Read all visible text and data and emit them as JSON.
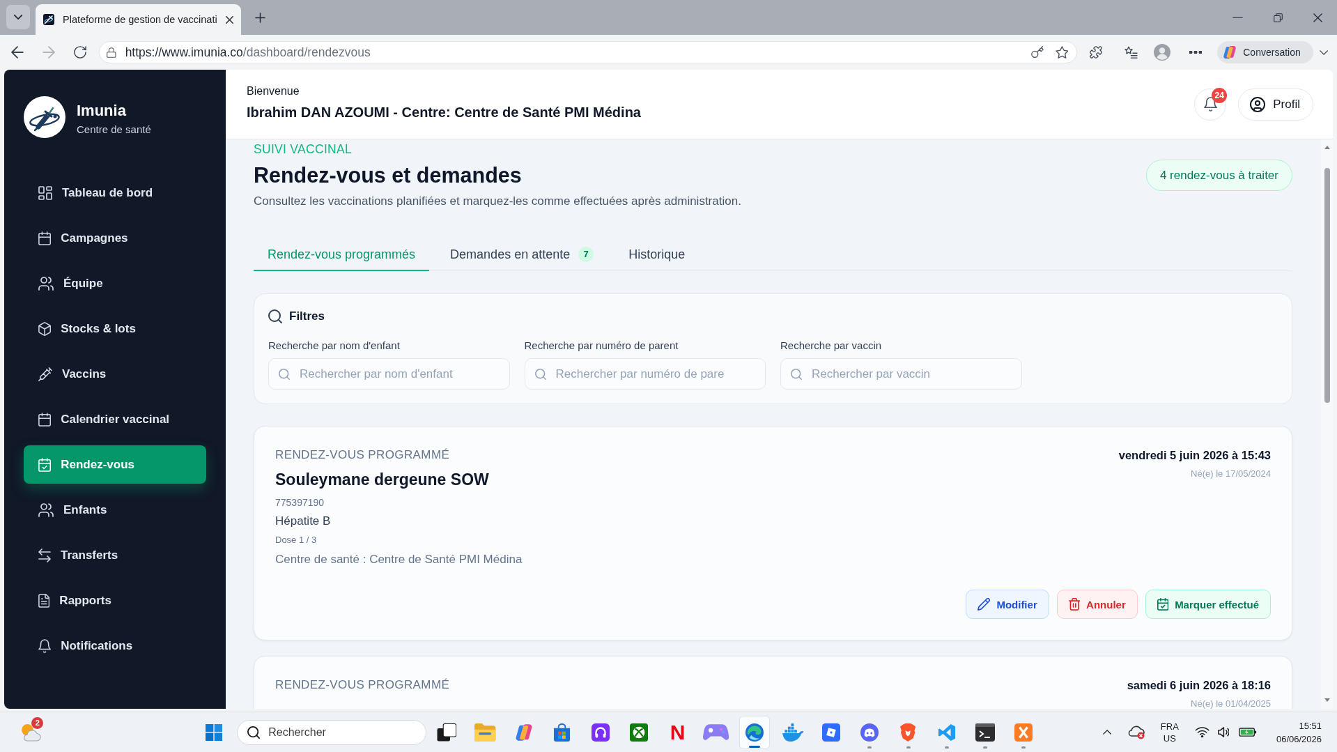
{
  "browser": {
    "tab": {
      "title": "Plateforme de gestion de vaccinati"
    },
    "nav": [
      {
        "kind": "back",
        "disabled": false
      },
      {
        "kind": "forward",
        "disabled": true
      },
      {
        "kind": "reload",
        "disabled": false
      }
    ],
    "address": {
      "origin": "https://www.imunia.co",
      "path": "/dashboard/rendezvous"
    },
    "assistant": {
      "label": "Conversation"
    }
  },
  "sidebar": {
    "brand": {
      "name": "Imunia",
      "subtitle": "Centre de santé"
    },
    "items": [
      {
        "kind": "dashboard",
        "label": "Tableau de bord",
        "selected": false
      },
      {
        "kind": "campaigns",
        "label": "Campagnes",
        "selected": false
      },
      {
        "kind": "team",
        "label": "Équipe",
        "selected": false
      },
      {
        "kind": "stock",
        "label": "Stocks & lots",
        "selected": false
      },
      {
        "kind": "vaccine",
        "label": "Vaccins",
        "selected": false
      },
      {
        "kind": "schedule",
        "label": "Calendrier vaccinal",
        "selected": false
      },
      {
        "kind": "appointments",
        "label": "Rendez-vous",
        "selected": true
      },
      {
        "kind": "children",
        "label": "Enfants",
        "selected": false
      },
      {
        "kind": "transfers",
        "label": "Transferts",
        "selected": false
      },
      {
        "kind": "reports",
        "label": "Rapports",
        "selected": false
      },
      {
        "kind": "notifications",
        "label": "Notifications",
        "selected": false
      }
    ]
  },
  "header": {
    "greeting": "Bienvenue",
    "user": "Ibrahim DAN AZOUMI - Centre: Centre de Santé PMI Médina",
    "notifications": {
      "count": "24"
    },
    "profile": {
      "label": "Profil"
    }
  },
  "page": {
    "eyebrow": "SUIVI VACCINAL",
    "title": "Rendez-vous et demandes",
    "description": "Consultez les vaccinations planifiées et marquez-les comme effectuées après administration.",
    "badge": "4 rendez-vous à traiter"
  },
  "tabs": [
    {
      "label": "Rendez-vous programmés",
      "selected": true
    },
    {
      "label": "Demandes en attente",
      "count": "7",
      "selected": false
    },
    {
      "label": "Historique",
      "selected": false
    }
  ],
  "filters": {
    "title": "Filtres",
    "fields": [
      {
        "label": "Recherche par nom d'enfant",
        "placeholder": "Rechercher par nom d'enfant"
      },
      {
        "label": "Recherche par numéro de parent",
        "placeholder": "Rechercher par numéro de pare"
      },
      {
        "label": "Recherche par vaccin",
        "placeholder": "Rechercher par vaccin"
      }
    ]
  },
  "appointments": [
    {
      "status": "RENDEZ-VOUS PROGRAMMÉ",
      "child": "Souleymane dergeune SOW",
      "phone": "775397190",
      "vaccine": "Hépatite B",
      "dose": "Dose 1 / 3",
      "center": "Centre de santé : Centre de Santé PMI Médina",
      "datetime": "vendredi 5 juin 2026 à 15:43",
      "birth": "Né(e) le 17/05/2024",
      "actions": [
        {
          "kind": "edit",
          "label": "Modifier"
        },
        {
          "kind": "cancel",
          "label": "Annuler"
        },
        {
          "kind": "done",
          "label": "Marquer effectué"
        }
      ]
    },
    {
      "status": "RENDEZ-VOUS PROGRAMMÉ",
      "datetime": "samedi 6 juin 2026 à 18:16",
      "birth": "Né(e) le 01/04/2025"
    }
  ],
  "taskbar": {
    "weather": {
      "badge": "2"
    },
    "search": {
      "placeholder": "Rechercher"
    },
    "apps": [
      {
        "kind": "taskview",
        "running": false,
        "selected": false
      },
      {
        "kind": "folder",
        "running": false,
        "selected": false
      },
      {
        "kind": "swirl",
        "running": false,
        "selected": false
      },
      {
        "kind": "bag",
        "running": false,
        "selected": false
      },
      {
        "kind": "headset",
        "running": false,
        "selected": false
      },
      {
        "kind": "sphere",
        "running": false,
        "selected": false
      },
      {
        "kind": "letter",
        "glyph": "N",
        "running": false,
        "selected": false
      },
      {
        "kind": "gamepad",
        "running": false,
        "selected": false
      },
      {
        "kind": "wave",
        "running": true,
        "selected": true
      },
      {
        "kind": "whale",
        "running": false,
        "selected": false
      },
      {
        "kind": "tilted",
        "running": false,
        "selected": false
      },
      {
        "kind": "face",
        "running": true,
        "selected": false
      },
      {
        "kind": "shield",
        "running": true,
        "selected": false
      },
      {
        "kind": "ribbon",
        "running": true,
        "selected": false
      },
      {
        "kind": "terminal",
        "running": true,
        "selected": false
      },
      {
        "kind": "cross",
        "running": true,
        "selected": false
      }
    ],
    "tray": {
      "language": {
        "input": "FRA",
        "region": "US"
      },
      "clock": {
        "time": "15:51",
        "date": "06/06/2026"
      }
    }
  }
}
